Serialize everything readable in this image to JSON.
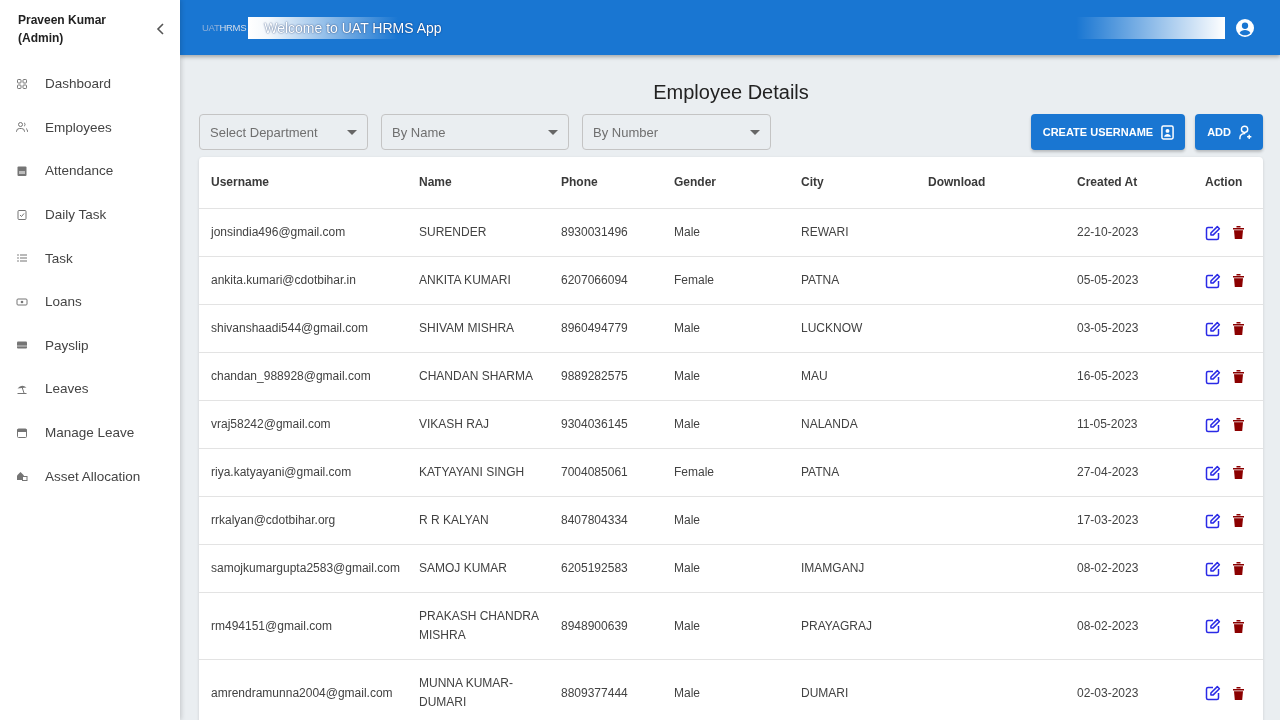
{
  "sidebar": {
    "user": "Praveen Kumar (Admin)",
    "items": [
      {
        "label": "Dashboard",
        "selected": false
      },
      {
        "label": "Employees",
        "selected": false
      },
      {
        "label": "Attendance",
        "selected": false
      },
      {
        "label": "Daily Task",
        "selected": false
      },
      {
        "label": "Task",
        "selected": false
      },
      {
        "label": "Loans",
        "selected": false
      },
      {
        "label": "Payslip",
        "selected": false
      },
      {
        "label": "Leaves",
        "selected": false
      },
      {
        "label": "Manage Leave",
        "selected": false
      },
      {
        "label": "Asset Allocation",
        "selected": false
      }
    ]
  },
  "header": {
    "logo": {
      "prefix": "UAT",
      "name": "HRMS"
    },
    "welcome": "Welcome to UAT HRMS App"
  },
  "content": {
    "title": "Employee Details",
    "filters": [
      {
        "placeholder": "Select Department"
      },
      {
        "placeholder": "By Name"
      },
      {
        "placeholder": "By Number"
      }
    ],
    "buttons": [
      {
        "label": "CREATE USERNAME",
        "kind": "create"
      },
      {
        "label": "ADD",
        "kind": "add"
      }
    ]
  },
  "table": {
    "columns": [
      "Username",
      "Name",
      "Phone",
      "Gender",
      "City",
      "Download",
      "Created At",
      "Action"
    ],
    "rows": [
      {
        "username": "jonsindia496@gmail.com",
        "name": "SURENDER",
        "phone": "8930031496",
        "gender": "Male",
        "city": "REWARI",
        "created_at": "22-10-2023"
      },
      {
        "username": "ankita.kumari@cdotbihar.in",
        "name": "ANKITA KUMARI",
        "phone": "6207066094",
        "gender": "Female",
        "city": "PATNA",
        "created_at": "05-05-2023"
      },
      {
        "username": "shivanshaadi544@gmail.com",
        "name": "SHIVAM MISHRA",
        "phone": "8960494779",
        "gender": "Male",
        "city": "LUCKNOW",
        "created_at": "03-05-2023"
      },
      {
        "username": "chandan_988928@gmail.com",
        "name": "CHANDAN SHARMA",
        "phone": "9889282575",
        "gender": "Male",
        "city": "MAU",
        "created_at": "16-05-2023"
      },
      {
        "username": "vraj58242@gmail.com",
        "name": "VIKASH RAJ",
        "phone": "9304036145",
        "gender": "Male",
        "city": "NALANDA",
        "created_at": "11-05-2023"
      },
      {
        "username": "riya.katyayani@gmail.com",
        "name": "KATYAYANI SINGH",
        "phone": "7004085061",
        "gender": "Female",
        "city": "PATNA",
        "created_at": "27-04-2023"
      },
      {
        "username": "rrkalyan@cdotbihar.org",
        "name": "R R KALYAN",
        "phone": "8407804334",
        "gender": "Male",
        "created_at": "17-03-2023"
      },
      {
        "username": "samojkumargupta2583@gmail.com",
        "name": "SAMOJ KUMAR",
        "phone": "6205192583",
        "gender": "Male",
        "city": "IMAMGANJ",
        "created_at": "08-02-2023"
      },
      {
        "username": "rm494151@gmail.com",
        "name": "PRAKASH CHANDRA MISHRA",
        "phone": "8948900639",
        "gender": "Male",
        "city": "PRAYAGRAJ",
        "created_at": "08-02-2023"
      },
      {
        "username": "amrendramunna2004@gmail.com",
        "name": "MUNNA KUMAR-DUMARI",
        "phone": "8809377444",
        "gender": "Male",
        "city": "DUMARI",
        "created_at": "02-03-2023"
      }
    ]
  }
}
